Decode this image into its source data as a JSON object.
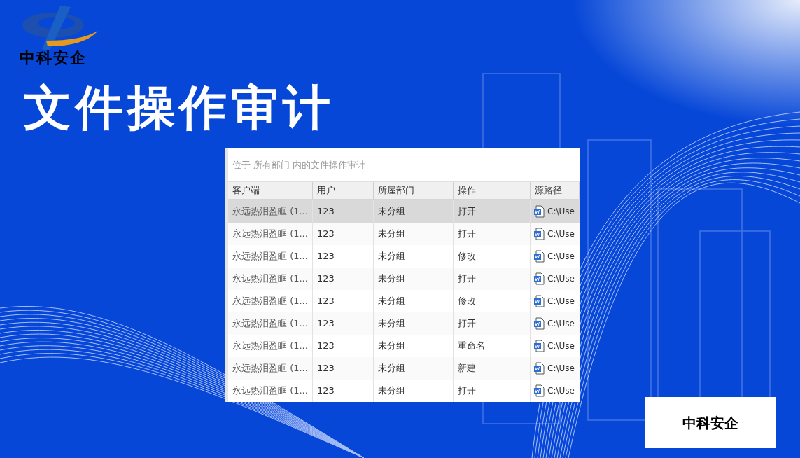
{
  "logo": {
    "text": "中科安企"
  },
  "headline": "文件操作审计",
  "panel": {
    "caption": "位于 所有部门 内的文件操作审计",
    "columns": [
      "客户端",
      "用户",
      "所屋部门",
      "操作",
      "源路径"
    ],
    "rows": [
      {
        "client": "永远热泪盈眶 (1...",
        "user": "123",
        "department": "未分组",
        "operation": "打开",
        "path": "C:\\Use",
        "selected": true
      },
      {
        "client": "永远热泪盈眶 (1...",
        "user": "123",
        "department": "未分组",
        "operation": "打开",
        "path": "C:\\Use",
        "selected": false
      },
      {
        "client": "永远热泪盈眶 (1...",
        "user": "123",
        "department": "未分组",
        "operation": "修改",
        "path": "C:\\Use",
        "selected": false
      },
      {
        "client": "永远热泪盈眶 (1...",
        "user": "123",
        "department": "未分组",
        "operation": "打开",
        "path": "C:\\Use",
        "selected": false
      },
      {
        "client": "永远热泪盈眶 (1...",
        "user": "123",
        "department": "未分组",
        "operation": "修改",
        "path": "C:\\Use",
        "selected": false
      },
      {
        "client": "永远热泪盈眶 (1...",
        "user": "123",
        "department": "未分组",
        "operation": "打开",
        "path": "C:\\Use",
        "selected": false
      },
      {
        "client": "永远热泪盈眶 (1...",
        "user": "123",
        "department": "未分组",
        "operation": "重命名",
        "path": "C:\\Use",
        "selected": false
      },
      {
        "client": "永远热泪盈眶 (1...",
        "user": "123",
        "department": "未分组",
        "operation": "新建",
        "path": "C:\\Use",
        "selected": false
      },
      {
        "client": "永远热泪盈眶 (1...",
        "user": "123",
        "department": "未分组",
        "operation": "打开",
        "path": "C:\\Use",
        "selected": false
      }
    ]
  },
  "badge": "中科安企"
}
